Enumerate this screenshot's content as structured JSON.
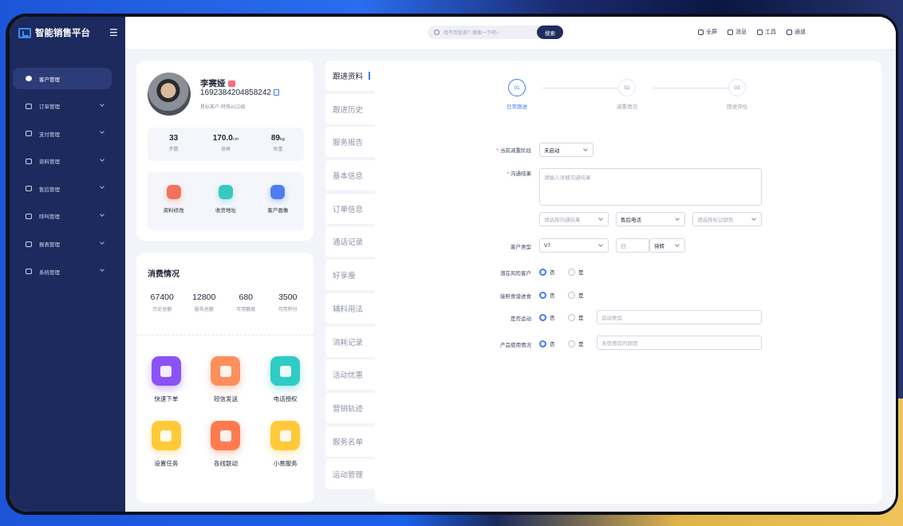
{
  "app": {
    "title": "智能销售平台"
  },
  "nav": {
    "items": [
      {
        "label": "客户管理",
        "active": true
      },
      {
        "label": "订单管理",
        "active": false
      },
      {
        "label": "支付管理",
        "active": false
      },
      {
        "label": "资料管理",
        "active": false
      },
      {
        "label": "售后管理",
        "active": false
      },
      {
        "label": "呼叫管理",
        "active": false
      },
      {
        "label": "报表管理",
        "active": false
      },
      {
        "label": "系统管理",
        "active": false
      }
    ]
  },
  "topbar": {
    "search_placeholder": "找不到信息？搜索一下吧~",
    "search_button": "搜索",
    "tools": [
      {
        "label": "全屏",
        "icon": "fullscreen-icon"
      },
      {
        "label": "消息",
        "icon": "message-icon"
      },
      {
        "label": "工具",
        "icon": "toolbox-icon"
      },
      {
        "label": "通道",
        "icon": "channel-icon"
      }
    ]
  },
  "profile": {
    "name": "李赛娅",
    "phone": "16923842048582​42",
    "desc": "星标客户-特殊ACD级",
    "stats": [
      {
        "value": "33",
        "unit": "",
        "label": "步数"
      },
      {
        "value": "170.0",
        "unit": "cm",
        "label": "身高"
      },
      {
        "value": "89",
        "unit": "kg",
        "label": "体重"
      }
    ],
    "quick": [
      {
        "label": "资料修改",
        "color": "#f2725c"
      },
      {
        "label": "收货地址",
        "color": "#39c9c0"
      },
      {
        "label": "客户画像",
        "color": "#4d7df2"
      }
    ]
  },
  "consumption": {
    "title": "消费情况",
    "items": [
      {
        "value": "67400",
        "label": "历史总额"
      },
      {
        "value": "12800",
        "label": "服务总额"
      },
      {
        "value": "680",
        "label": "可用额度"
      },
      {
        "value": "3500",
        "label": "可用积分"
      }
    ],
    "apps": [
      {
        "label": "快速下单",
        "color": "#8b52f6"
      },
      {
        "label": "短信发送",
        "color": "#ff8f5a"
      },
      {
        "label": "电话授权",
        "color": "#2fcbc4"
      },
      {
        "label": "设置任务",
        "color": "#ffc93a"
      },
      {
        "label": "各线联动",
        "color": "#ff7b4f"
      },
      {
        "label": "小易服务",
        "color": "#ffc93a"
      }
    ]
  },
  "tabs": [
    "跟进资料",
    "跟进历史",
    "服务报告",
    "基本信息",
    "订单信息",
    "通话记录",
    "好享瘦",
    "辅料用法",
    "消耗记录",
    "活动优惠",
    "营销轨迹",
    "服务名单",
    "运动管理"
  ],
  "steps": [
    {
      "num": "01",
      "label": "日常跟进",
      "active": true
    },
    {
      "num": "02",
      "label": "减重情况",
      "active": false
    },
    {
      "num": "03",
      "label": "跟进评估",
      "active": false
    }
  ],
  "form": {
    "stage_label": "当前减重阶段",
    "stage_value": "未启动",
    "comm_label": "沟通结果",
    "comm_placeholder": "请输入详细沟通结果",
    "comm_result_placeholder": "请选择沟通结果",
    "after_sale_value": "售后电话",
    "color_placeholder": "请选择标记颜色",
    "type_label": "客户类型",
    "type_value": "V7",
    "old_value": "旧",
    "pending_value": "待转",
    "risk_label": "潜在风险客户",
    "diet_label": "接照食谱进食",
    "sport_label": "是否运动",
    "sport_placeholder": "运动类型",
    "product_label": "产品使用情况",
    "product_placeholder": "未使用完的原因",
    "no": "否",
    "yes": "是"
  }
}
